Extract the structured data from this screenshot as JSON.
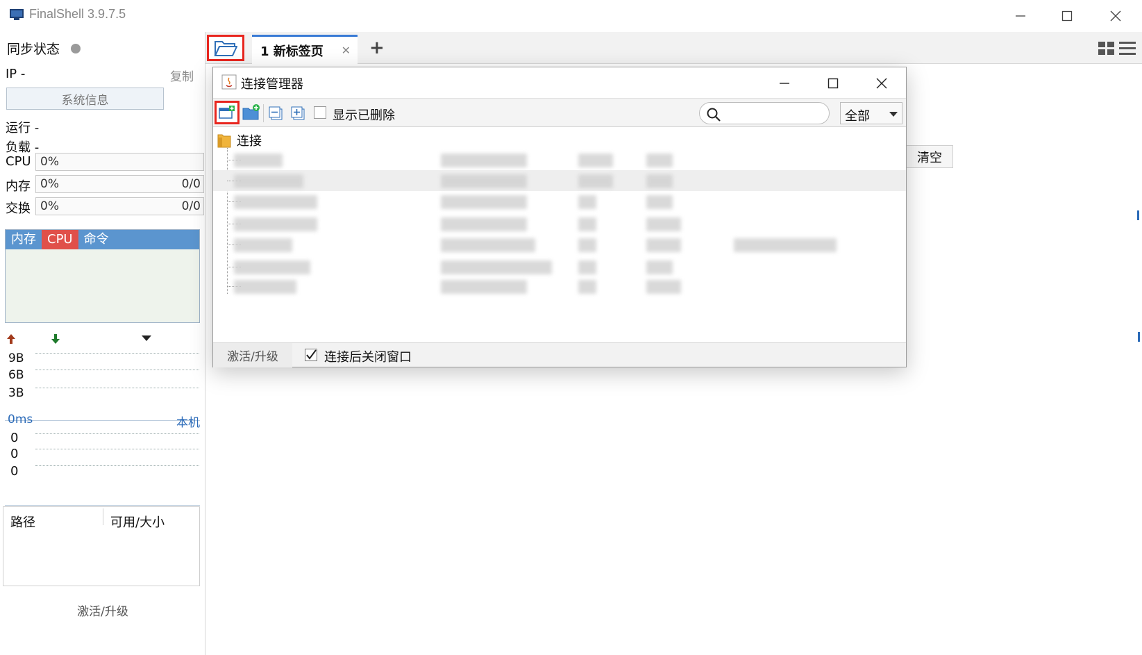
{
  "window": {
    "title": "FinalShell 3.9.7.5"
  },
  "sidebar": {
    "sync_label": "同步状态",
    "ip_label": "IP  -",
    "copy_label": "复制",
    "sysinfo_button": "系统信息",
    "run_label": "运行 -",
    "load_label": "负载 -",
    "meters": [
      {
        "label": "CPU",
        "percent": "0%",
        "ratio": ""
      },
      {
        "label": "内存",
        "percent": "0%",
        "ratio": "0/0"
      },
      {
        "label": "交换",
        "percent": "0%",
        "ratio": "0/0"
      }
    ],
    "proc_tabs": [
      "内存",
      "CPU",
      "命令"
    ],
    "net_ticks": [
      "9B",
      "6B",
      "3B"
    ],
    "ping": {
      "latency": "0ms",
      "host": "本机",
      "values": [
        "0",
        "0",
        "0"
      ]
    },
    "disk_headers": [
      "路径",
      "可用/大小"
    ],
    "activate_label": "激活/升级"
  },
  "tabs": [
    {
      "label": "1 新标签页"
    }
  ],
  "clear_button": "清空",
  "dialog": {
    "title": "连接管理器",
    "show_deleted_label": "显示已删除",
    "search_placeholder": "",
    "filter_value": "全部",
    "tree_root": "连接",
    "activate_label": "激活/升级",
    "close_after_connect_label": "连接后关闭窗口",
    "close_after_connect_checked": true
  },
  "colors": {
    "accent_blue": "#5b95cf",
    "highlight_red": "#e8261f",
    "active_tab_red": "#e0504a",
    "link_blue": "#2a6ab8"
  },
  "icons": {
    "app": "finalshell-icon",
    "open_folder": "folder-open-icon",
    "new_connection": "new-connection-icon",
    "new_folder": "new-folder-icon",
    "collapse": "collapse-all-icon",
    "expand": "expand-all-icon",
    "search": "search-icon",
    "view_grid": "grid-view-icon",
    "view_list": "list-view-icon"
  }
}
